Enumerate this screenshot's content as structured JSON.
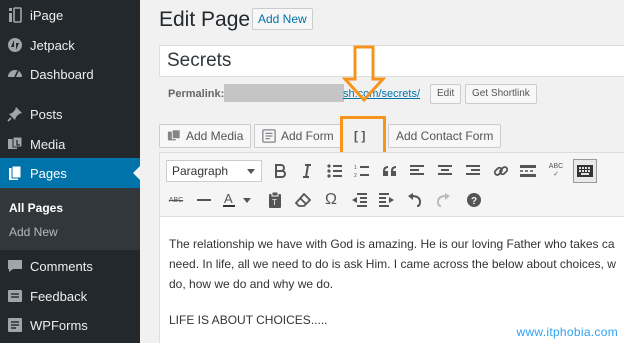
{
  "sidebar": {
    "items": [
      {
        "label": "iPage",
        "icon": "ipage-icon"
      },
      {
        "label": "Jetpack",
        "icon": "jetpack-icon"
      },
      {
        "label": "Dashboard",
        "icon": "dashboard-icon"
      },
      {
        "label": "Posts",
        "icon": "pin-icon"
      },
      {
        "label": "Media",
        "icon": "media-icon"
      },
      {
        "label": "Pages",
        "icon": "pages-icon",
        "active": true
      },
      {
        "label": "Comments",
        "icon": "comments-icon"
      },
      {
        "label": "Feedback",
        "icon": "feedback-icon"
      },
      {
        "label": "WPForms",
        "icon": "wpforms-icon"
      }
    ],
    "submenu": [
      {
        "label": "All Pages",
        "current": true
      },
      {
        "label": "Add New"
      }
    ]
  },
  "header": {
    "title": "Edit Page",
    "add_new_label": "Add New"
  },
  "post": {
    "title": "Secrets"
  },
  "permalink": {
    "label": "Permalink:",
    "url_visible": "sh.com/secrets/",
    "edit_label": "Edit",
    "shortlink_label": "Get Shortlink"
  },
  "media_buttons": {
    "add_media": "Add Media",
    "add_form": "Add Form",
    "shortcode": "[ ]",
    "add_contact_form": "Add Contact Form"
  },
  "toolbar": {
    "format_value": "Paragraph",
    "abc_label": "ABC",
    "abc_strike_label": "ABC"
  },
  "content": {
    "lines": [
      "The relationship we have with God is amazing. He is our loving Father who takes ca",
      "need. In life, all we need to do is ask Him. I came across the below about choices, w",
      "do, how we do and why we do.",
      "LIFE IS ABOUT CHOICES....."
    ]
  },
  "watermark": "www.itphobia.com",
  "colors": {
    "sidebar_bg": "#23282d",
    "active_blue": "#0073aa",
    "annotation_orange": "#f7941d"
  }
}
